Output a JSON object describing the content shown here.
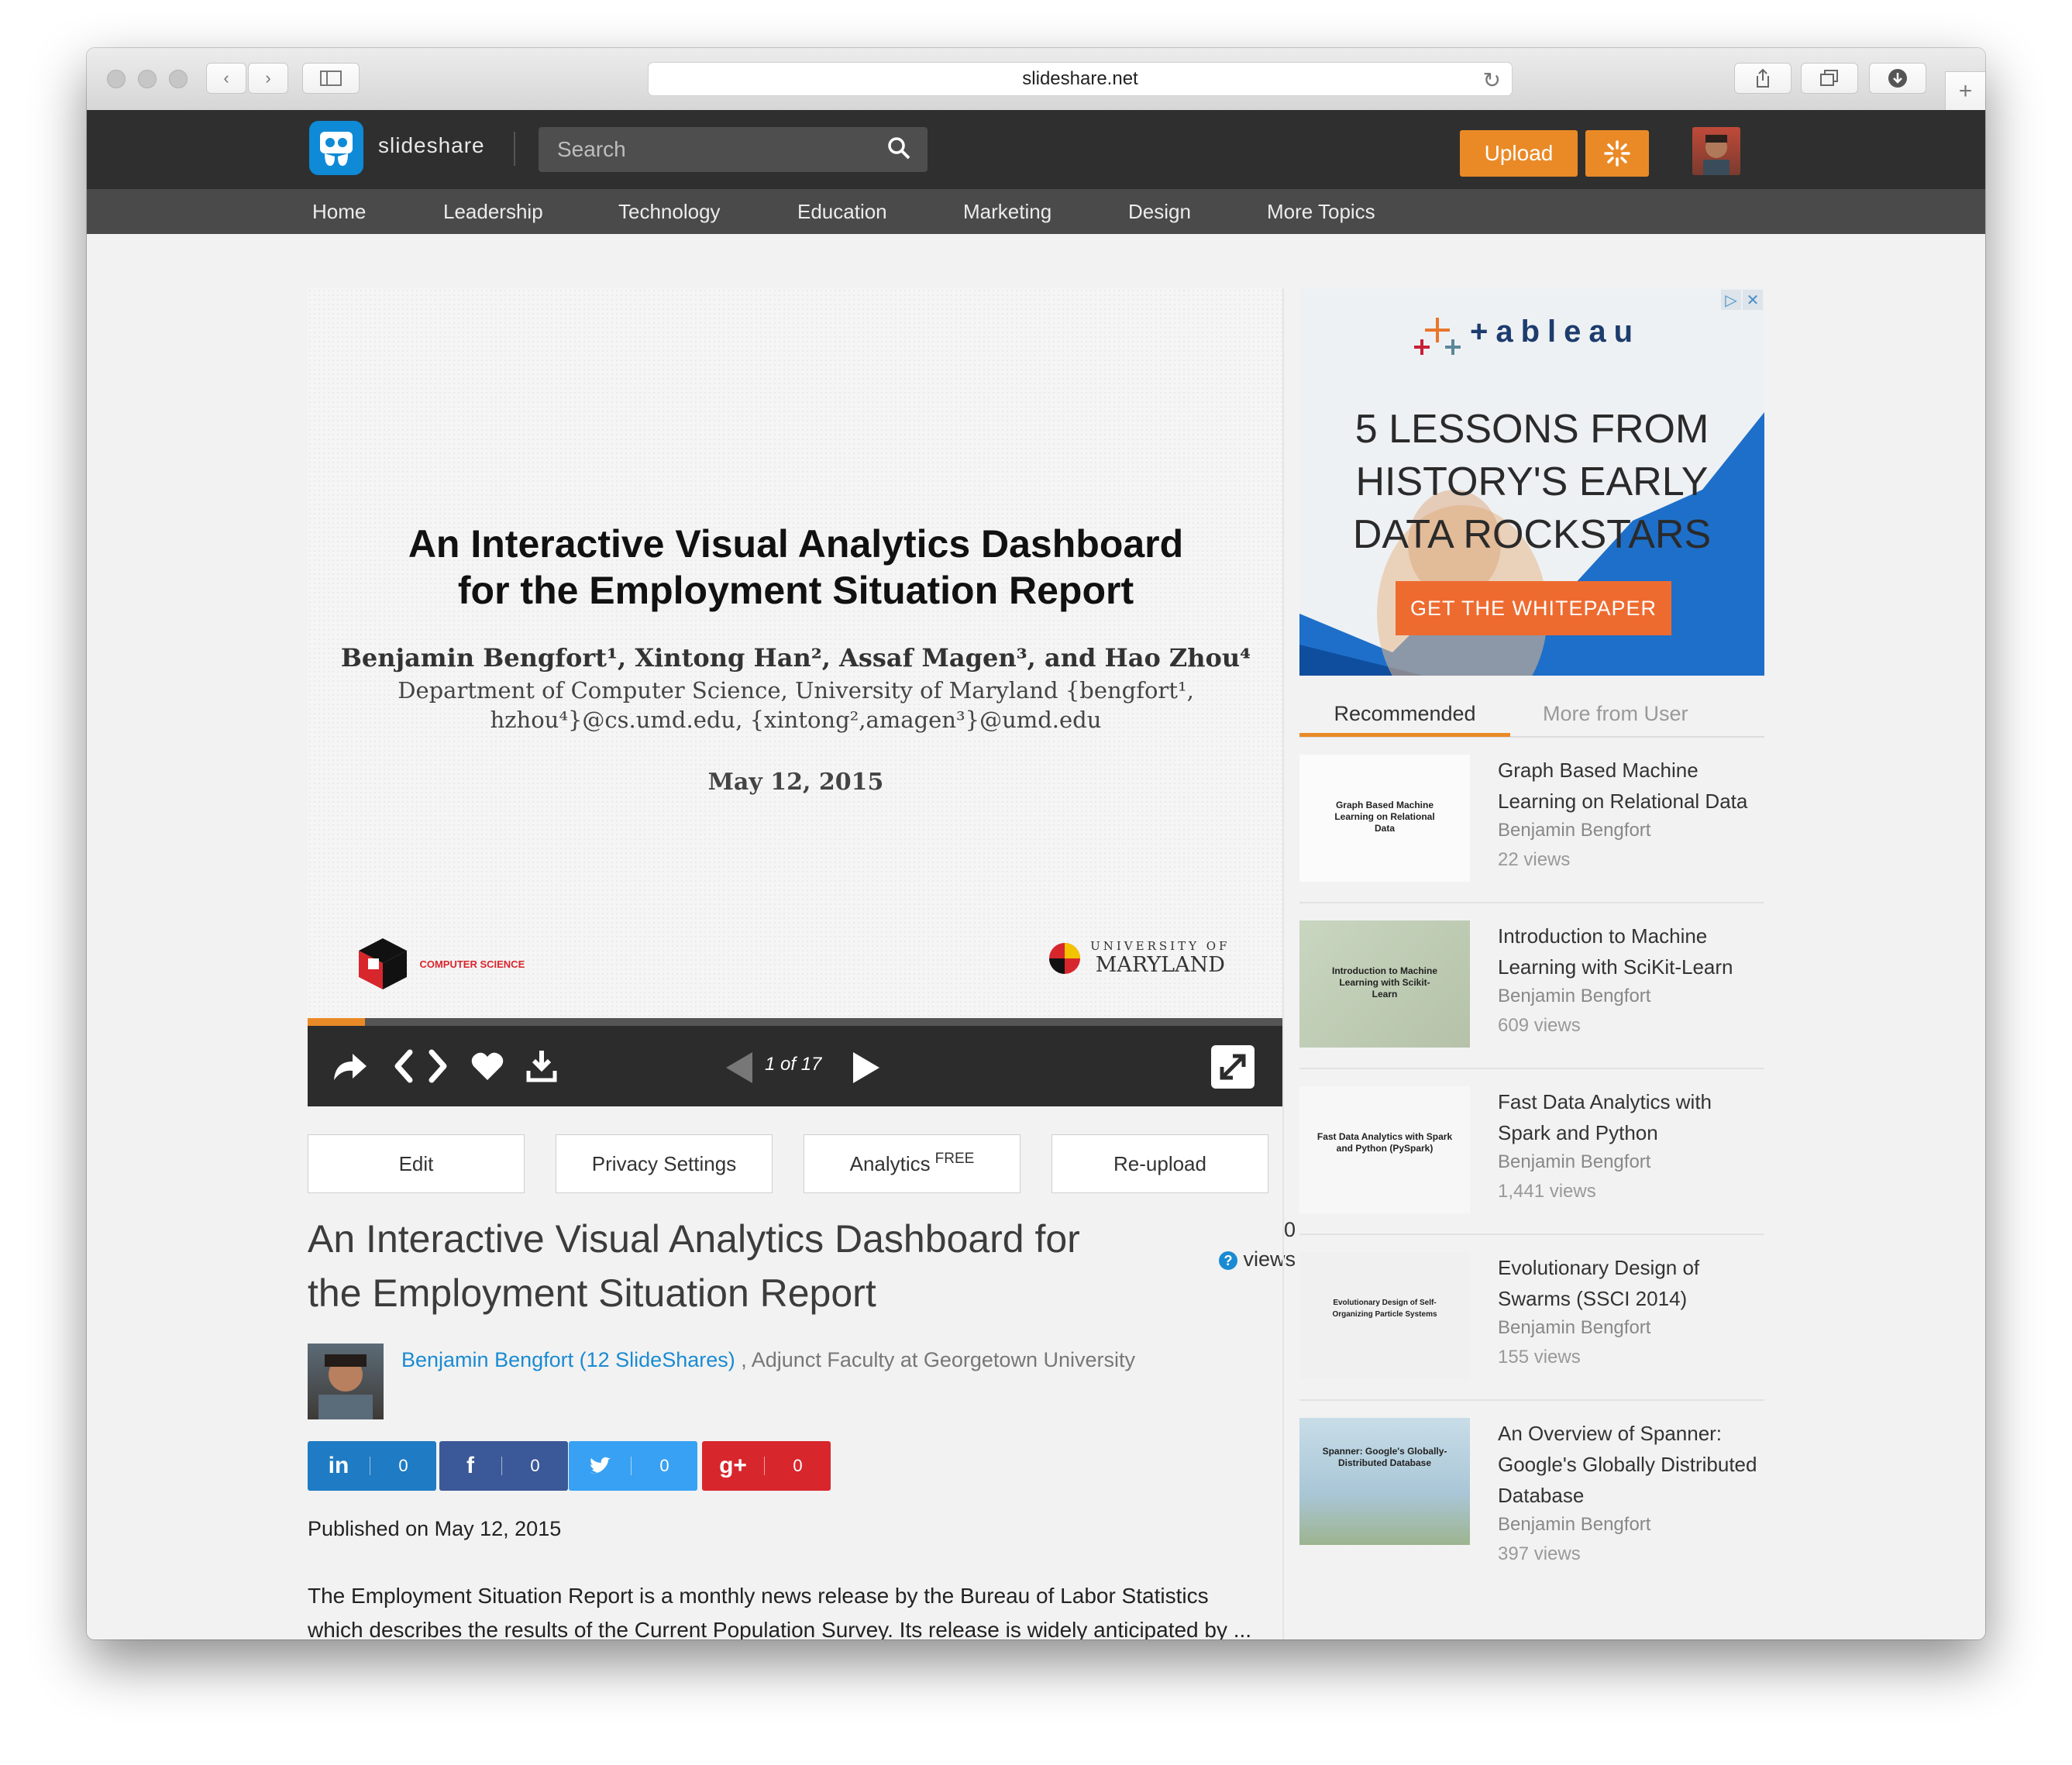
{
  "browser": {
    "url": "slideshare.net"
  },
  "header": {
    "brand": "slideshare",
    "search_placeholder": "Search",
    "upload_label": "Upload"
  },
  "nav": [
    "Home",
    "Leadership",
    "Technology",
    "Education",
    "Marketing",
    "Design",
    "More Topics"
  ],
  "slide": {
    "title_line1": "An Interactive Visual Analytics Dashboard",
    "title_line2": "for the Employment Situation Report",
    "authors": "Benjamin Bengfort¹, Xintong Han², Assaf Magen³, and Hao Zhou⁴",
    "dept_line1": "Department of Computer Science, University of Maryland {bengfort¹,",
    "dept_line2": "hzhou⁴}@cs.umd.edu, {xintong²,amagen³}@umd.edu",
    "date": "May 12, 2015",
    "cs_logo_text": "COMPUTER SCIENCE",
    "umd_line1": "UNIVERSITY OF",
    "umd_line2": "MARYLAND",
    "progress_fraction": 0.0588
  },
  "player": {
    "pager": "1 of 17"
  },
  "actions": {
    "edit": "Edit",
    "privacy": "Privacy Settings",
    "analytics": "Analytics",
    "analytics_badge": "FREE",
    "reupload": "Re-upload"
  },
  "document": {
    "title": "An Interactive Visual Analytics Dashboard for the Employment Situation Report",
    "views_count": "0",
    "views_label": "views",
    "author_link": "Benjamin Bengfort (12 SlideShares)",
    "author_role": ", Adjunct Faculty at Georgetown University",
    "published": "Published on May 12, 2015",
    "description_line1": "The Employment Situation Report is a monthly news release by the Bureau of Labor Statistics",
    "description_line2": "which describes the results of the Current Population Survey. Its release is widely anticipated by ..."
  },
  "share": [
    {
      "icon": "in",
      "count": "0",
      "color": "#1f7bc4"
    },
    {
      "icon": "f",
      "count": "0",
      "color": "#3b5998"
    },
    {
      "icon": "t",
      "count": "0",
      "color": "#38a1f3"
    },
    {
      "icon": "g+",
      "count": "0",
      "color": "#d8262d"
    }
  ],
  "ad": {
    "brand": "+ableau",
    "headline_line1": "5 LESSONS FROM",
    "headline_line2": "HISTORY'S EARLY",
    "headline_line3": "DATA ROCKSTARS",
    "cta": "GET THE WHITEPAPER"
  },
  "sidebar": {
    "tab_recommended": "Recommended",
    "tab_more": "More from User",
    "items": [
      {
        "title": "Graph Based Machine Learning on Relational Data",
        "author": "Benjamin Bengfort",
        "views": "22 views",
        "thumb_text": "Graph Based Machine Learning on Relational Data"
      },
      {
        "title": "Introduction to Machine Learning with SciKit-Learn",
        "author": "Benjamin Bengfort",
        "views": "609 views",
        "thumb_text": "Introduction to Machine Learning with Scikit-Learn"
      },
      {
        "title": "Fast Data Analytics with Spark and Python",
        "author": "Benjamin Bengfort",
        "views": "1,441 views",
        "thumb_text": "Fast Data Analytics with Spark and Python (PySpark)"
      },
      {
        "title": "Evolutionary Design of Swarms (SSCI 2014)",
        "author": "Benjamin Bengfort",
        "views": "155 views",
        "thumb_text": "Evolutionary Design of Self-Organizing Particle Systems"
      },
      {
        "title": "An Overview of Spanner: Google's Globally Distributed Database",
        "author": "Benjamin Bengfort",
        "views": "397 views",
        "thumb_text": "Spanner: Google's Globally-Distributed Database"
      }
    ]
  }
}
